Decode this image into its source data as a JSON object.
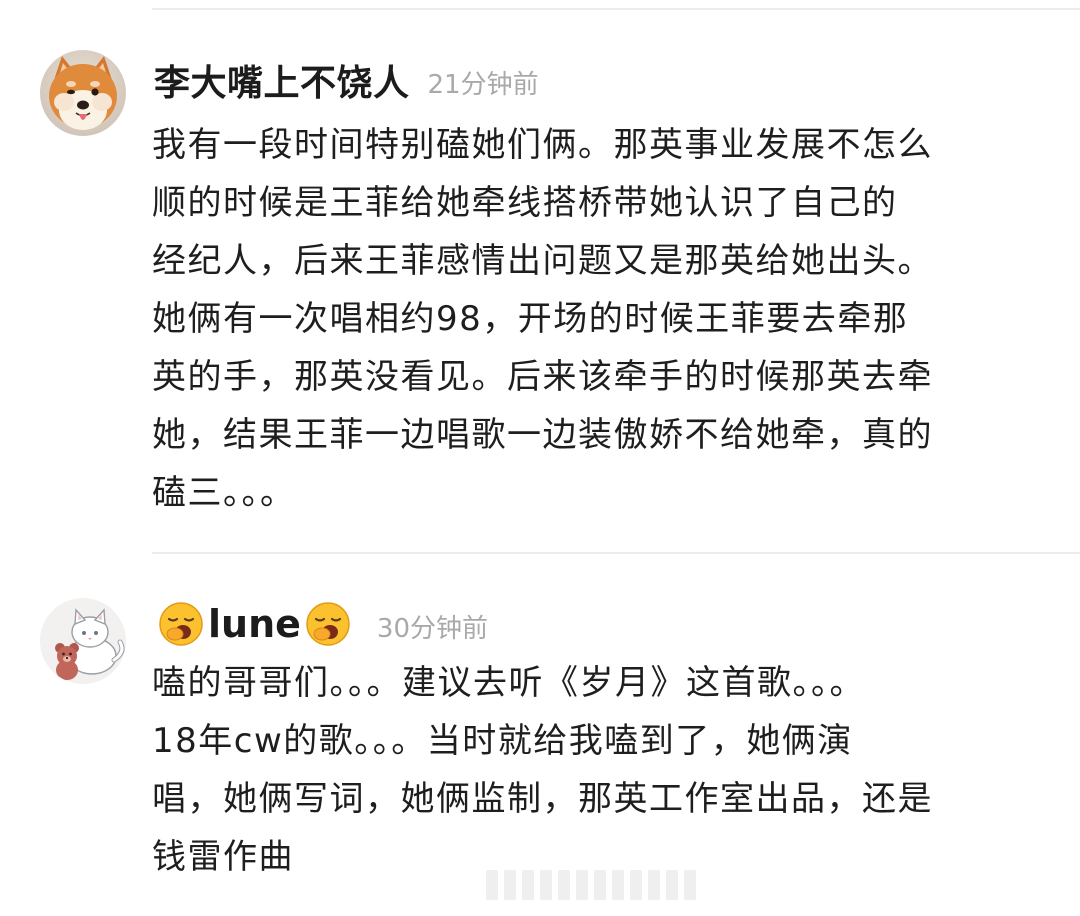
{
  "comments": [
    {
      "username": "李大嘴上不饶人",
      "timestamp": "21分钟前",
      "avatar": "shiba-inu-dog-avatar",
      "text": "我有一段时间特别磕她们俩。那英事业发展不怎么\n顺的时候是王菲给她牵线搭桥带她认识了自己的\n经纪人，后来王菲感情出问题又是那英给她出头。\n她俩有一次唱相约98，开场的时候王菲要去牵那\n英的手，那英没看见。后来该牵手的时候那英去牵\n她，结果王菲一边唱歌一边装傲娇不给她牵，真的\n磕三。。。"
    },
    {
      "username": "lune",
      "username_emoji": "yawning-face-emoji",
      "timestamp": "30分钟前",
      "avatar": "white-cat-with-teddy-bear-avatar",
      "text": "嗑的哥哥们。。。建议去听《岁月》这首歌。。。\n18年cw的歌。。。当时就给我嗑到了，她俩演\n唱，她俩写词，她俩监制，那英工作室出品，还是\n钱雷作曲"
    }
  ],
  "colors": {
    "username": "#1c1c1c",
    "timestamp": "#a9a9a9",
    "body": "#1e1e1e",
    "divider": "#ececec",
    "background": "#ffffff"
  }
}
